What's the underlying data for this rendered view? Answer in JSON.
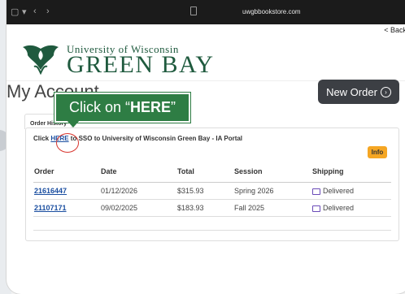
{
  "browser": {
    "url": "uwgbbookstore.com"
  },
  "nav": {
    "back_label": "< Back"
  },
  "header": {
    "university_top": "University of Wisconsin",
    "university_name": "GREEN BAY"
  },
  "page": {
    "title": "My Account",
    "new_order_label": "New Order"
  },
  "tabs": [
    {
      "label": "Order History"
    }
  ],
  "panel": {
    "sso_prefix": "Click ",
    "sso_link": "HERE",
    "sso_suffix": " to SSO to University of Wisconsin Green Bay - IA Portal",
    "info_label": "Info"
  },
  "table": {
    "headers": [
      "Order",
      "Date",
      "Total",
      "Session",
      "Shipping"
    ],
    "rows": [
      {
        "order": "21616447",
        "date": "01/12/2026",
        "total": "$315.93",
        "session": "Spring 2026",
        "shipping": "Delivered"
      },
      {
        "order": "21107171",
        "date": "09/02/2025",
        "total": "$183.93",
        "session": "Fall 2025",
        "shipping": "Delivered"
      }
    ]
  },
  "tooltip": {
    "prefix": "Click on “",
    "bold": "HERE",
    "suffix": "”"
  },
  "colors": {
    "brand_green": "#1f5a3e",
    "tooltip_green": "#2e7d44",
    "link_blue": "#1a4ea0",
    "info_orange": "#f5a623",
    "highlight_red": "#d8362e"
  }
}
